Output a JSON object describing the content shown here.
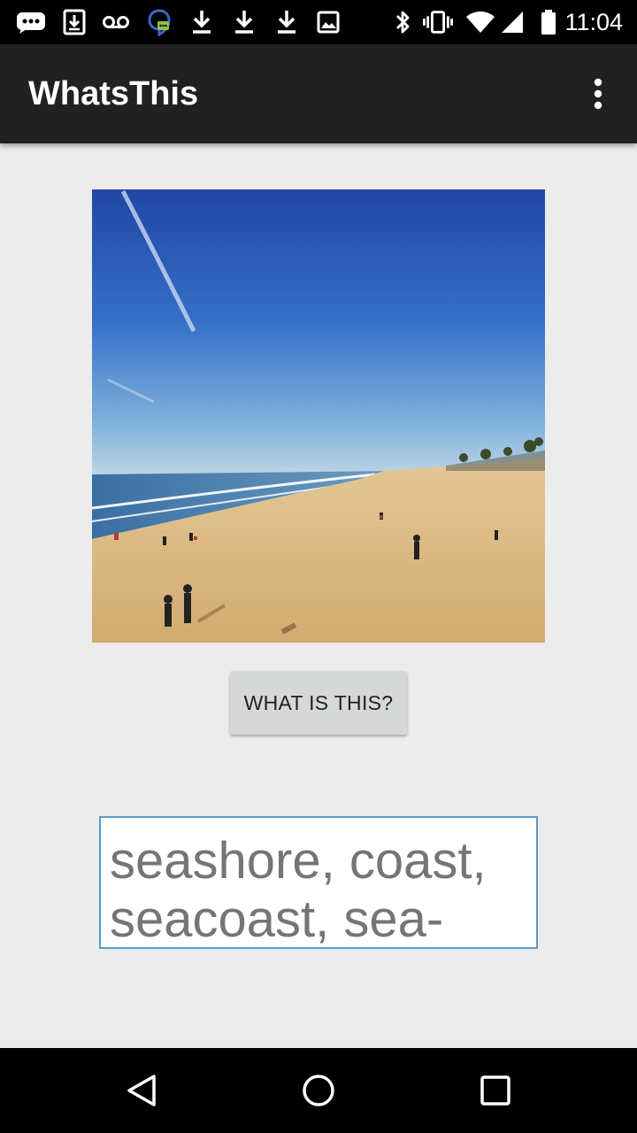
{
  "status_bar": {
    "time": "11:04",
    "left_icons": [
      "messenger-notification-icon",
      "download-box-icon",
      "voicemail-icon",
      "hangouts-icon",
      "download-icon",
      "download-icon",
      "download-icon",
      "image-icon"
    ],
    "right_icons": [
      "bluetooth-icon",
      "vibrate-icon",
      "wifi-icon",
      "cell-signal-icon",
      "battery-icon"
    ]
  },
  "app_bar": {
    "title": "WhatsThis",
    "overflow_icon": "more-vert-icon"
  },
  "main": {
    "photo_subject": "beach-photo",
    "button_label": "WHAT IS THIS?",
    "result_text": "seashore, coast, seacoast, sea-coast"
  },
  "nav_bar": {
    "icons": [
      "back-icon",
      "home-icon",
      "recents-icon"
    ]
  },
  "colors": {
    "app_bar": "#212121",
    "background": "#ececec",
    "result_border": "#5b9bc9",
    "button": "#d6d7d7"
  }
}
